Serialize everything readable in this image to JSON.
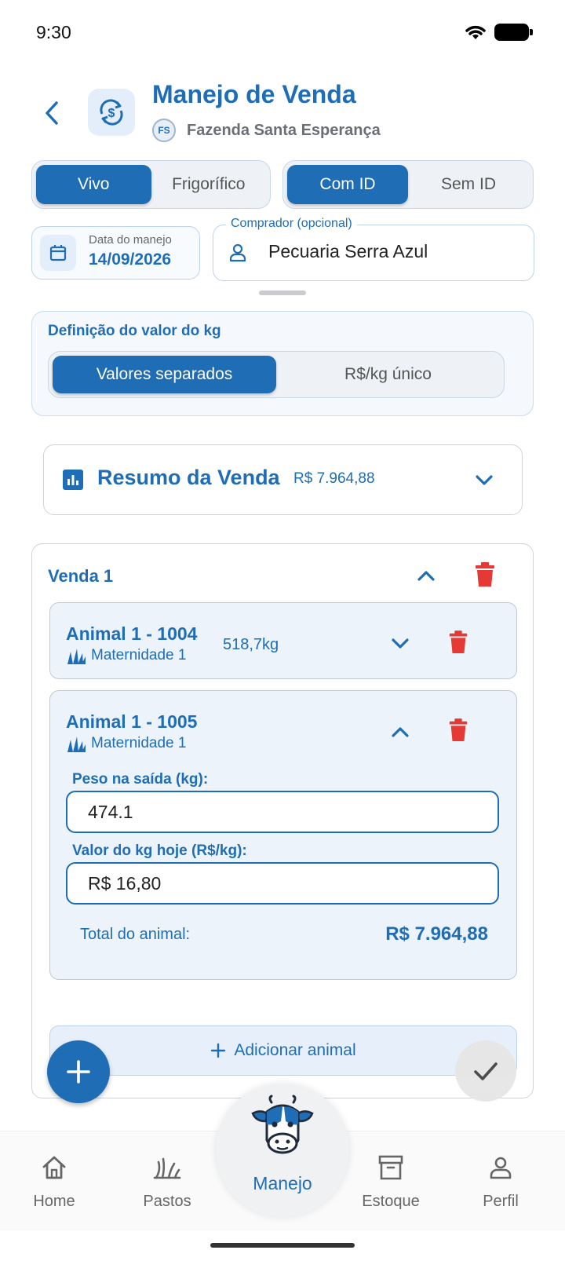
{
  "status_bar": {
    "time": "9:30"
  },
  "header": {
    "title": "Manejo de Venda",
    "farm_initials": "FS",
    "farm_name": "Fazenda Santa Esperança"
  },
  "toggles": {
    "type": {
      "options": [
        "Vivo",
        "Frigorífico"
      ],
      "selected": "Vivo"
    },
    "id_mode": {
      "options": [
        "Com ID",
        "Sem ID"
      ],
      "selected": "Com ID"
    }
  },
  "date_field": {
    "label": "Data do manejo",
    "value": "14/09/2026"
  },
  "buyer_field": {
    "label": "Comprador (opcional)",
    "value": "Pecuaria Serra Azul"
  },
  "kg_definition": {
    "title": "Definição do valor do kg",
    "options": [
      "Valores separados",
      "R$/kg único"
    ],
    "selected": "Valores separados"
  },
  "summary": {
    "title": "Resumo da Venda",
    "total": "R$ 7.964,88"
  },
  "sale": {
    "title": "Venda 1",
    "animals": [
      {
        "title": "Animal 1 - 1004",
        "pasture": "Maternidade 1",
        "weight": "518,7kg",
        "expanded": false
      },
      {
        "title": "Animal 1 - 1005",
        "pasture": "Maternidade 1",
        "expanded": true,
        "weight_label": "Peso na saída (kg):",
        "weight_value": "474.1",
        "price_label": "Valor do kg hoje (R$/kg):",
        "price_value": "R$ 16,80",
        "total_label": "Total do animal:",
        "total_value": "R$ 7.964,88"
      }
    ],
    "add_animal_label": "Adicionar animal"
  },
  "bottom_nav": {
    "items": [
      "Home",
      "Pastos",
      "Manejo",
      "Estoque",
      "Perfil"
    ],
    "active": "Manejo"
  },
  "colors": {
    "primary": "#1e6db5",
    "danger": "#e53935"
  }
}
